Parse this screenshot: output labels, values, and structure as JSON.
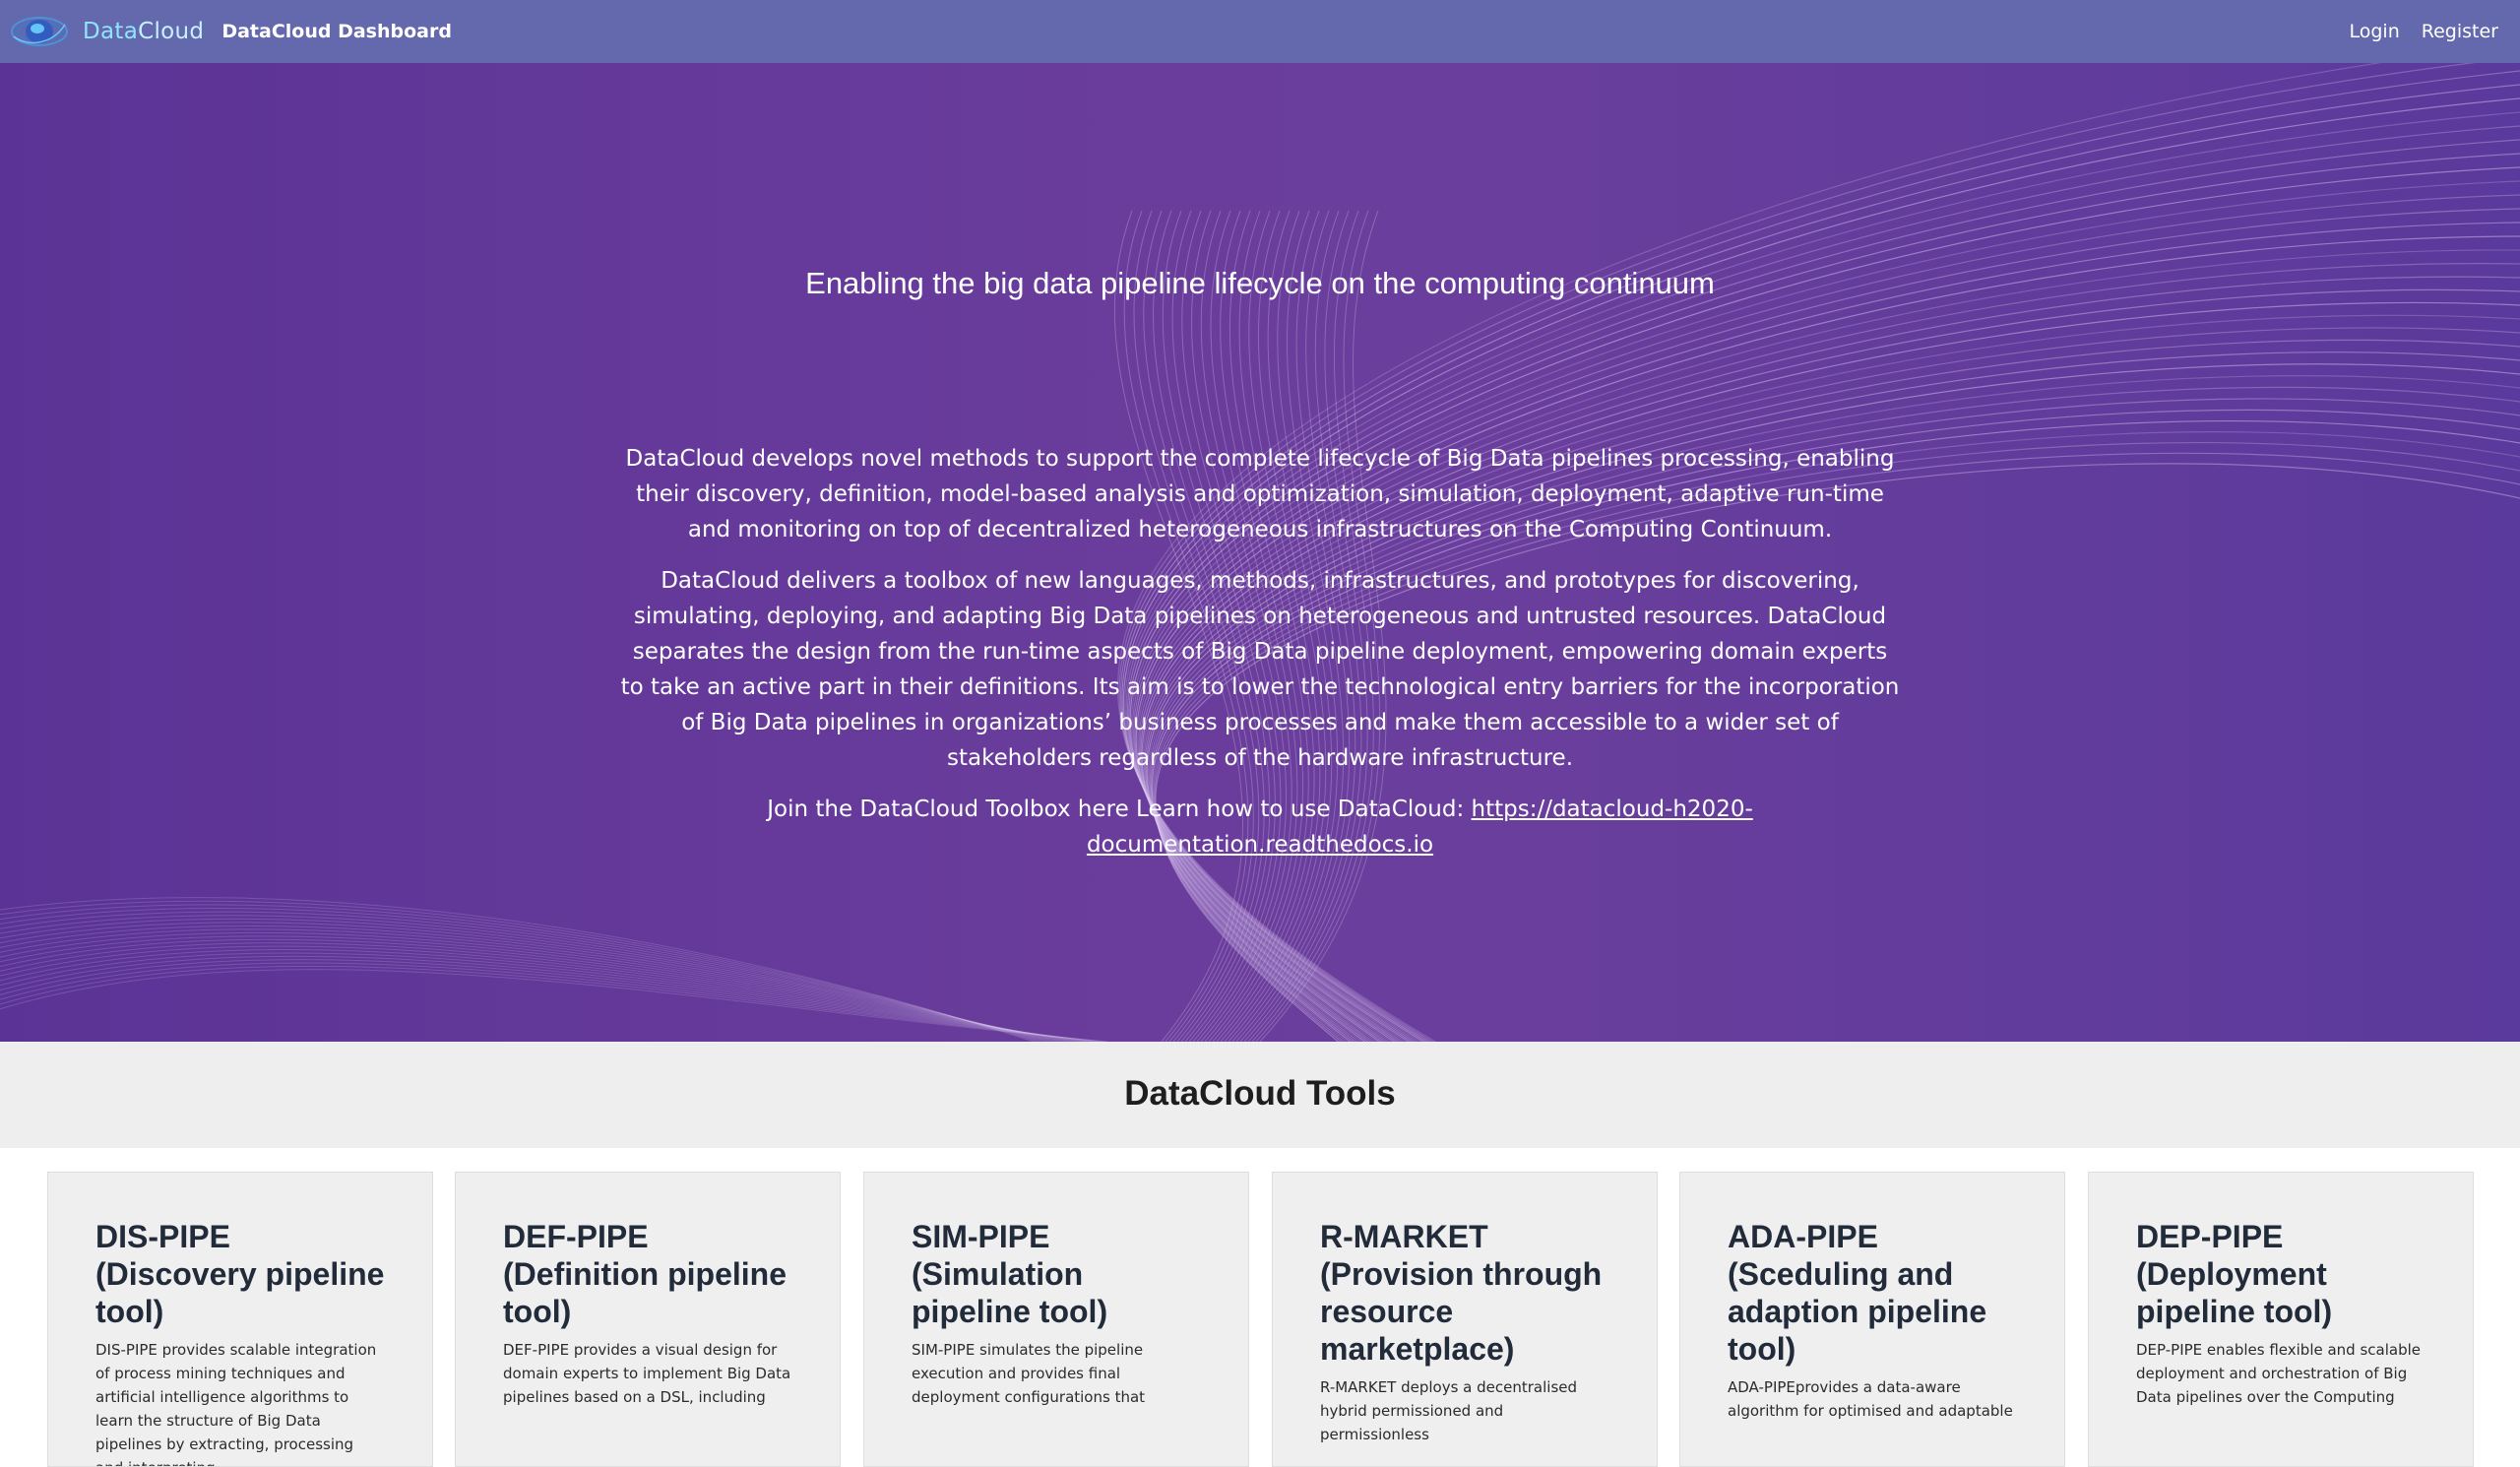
{
  "navbar": {
    "brand_data": "Data",
    "brand_cloud": "Cloud",
    "dashboard_title": "DataCloud Dashboard",
    "login": "Login",
    "register": "Register"
  },
  "hero": {
    "heading": "Enabling the big data pipeline lifecycle on the computing continuum",
    "paragraph1": "DataCloud develops novel methods to support the complete lifecycle of Big Data pipelines processing, enabling their discovery, definition, model-based analysis and optimization, simulation, deployment, adaptive run-time and monitoring on top of decentralized heterogeneous infrastructures on the Computing Continuum.",
    "paragraph2": "DataCloud delivers a toolbox of new languages, methods, infrastructures, and prototypes for discovering, simulating, deploying, and adapting Big Data pipelines on heterogeneous and untrusted resources. DataCloud separates the design from the run-time aspects of Big Data pipeline deployment, empowering domain experts to take an active part in their definitions. Its aim is to lower the technological entry barriers for the incorporation of Big Data pipelines in organizations’ business processes and make them accessible to a wider set of stakeholders regardless of the hardware infrastructure.",
    "join_text": "Join the DataCloud Toolbox here Learn how to use DataCloud: ",
    "doc_link": "https://datacloud-h2020-documentation.readthedocs.io"
  },
  "tools": {
    "title": "DataCloud Tools",
    "cards": [
      {
        "title": "DIS-PIPE (Discovery pipeline tool)",
        "description": "DIS-PIPE provides scalable integration of process mining techniques and artificial intelligence algorithms to learn the structure of Big Data pipelines by extracting, processing and interpreting"
      },
      {
        "title": "DEF-PIPE (Definition pipeline tool)",
        "description": "DEF-PIPE provides a visual design for domain experts to implement Big Data pipelines based on a DSL, including"
      },
      {
        "title": "SIM-PIPE (Simulation pipeline tool)",
        "description": "SIM-PIPE simulates the pipeline execution and provides final deployment configurations that"
      },
      {
        "title": "R-MARKET (Provision through resource marketplace)",
        "description": "R-MARKET deploys a decentralised hybrid permissioned and permissionless"
      },
      {
        "title": "ADA-PIPE (Sceduling and adaption pipeline tool)",
        "description": "ADA-PIPEprovides a data-aware algorithm for optimised and adaptable"
      },
      {
        "title": "DEP-PIPE (Deployment pipeline tool)",
        "description": "DEP-PIPE enables flexible and scalable deployment and orchestration of Big Data pipelines over the Computing"
      }
    ]
  },
  "colors": {
    "navbar_bg": "#6468ad",
    "hero_bg": "#6a3e9c",
    "tools_band_bg": "#eeeeee",
    "card_bg": "#efefef",
    "brand_accent": "#8fe6ff"
  }
}
